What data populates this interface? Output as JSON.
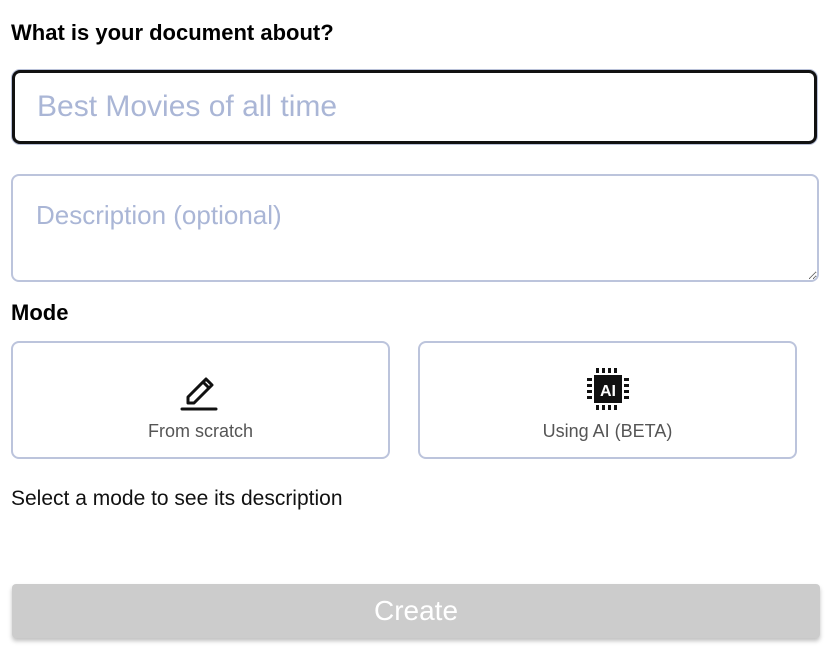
{
  "form": {
    "heading": "What is your document about?",
    "title_placeholder": "Best Movies of all time",
    "title_value": "",
    "description_placeholder": "Description (optional)",
    "description_value": ""
  },
  "mode": {
    "label": "Mode",
    "options": [
      {
        "label": "From scratch",
        "icon": "pencil-icon"
      },
      {
        "label": "Using AI (BETA)",
        "icon": "ai-chip-icon"
      }
    ],
    "hint": "Select a mode to see its description"
  },
  "actions": {
    "create_label": "Create",
    "create_disabled": true
  },
  "colors": {
    "input_border": "#bcc4dc",
    "placeholder": "#aab6d6",
    "disabled_button": "#cccccc"
  }
}
